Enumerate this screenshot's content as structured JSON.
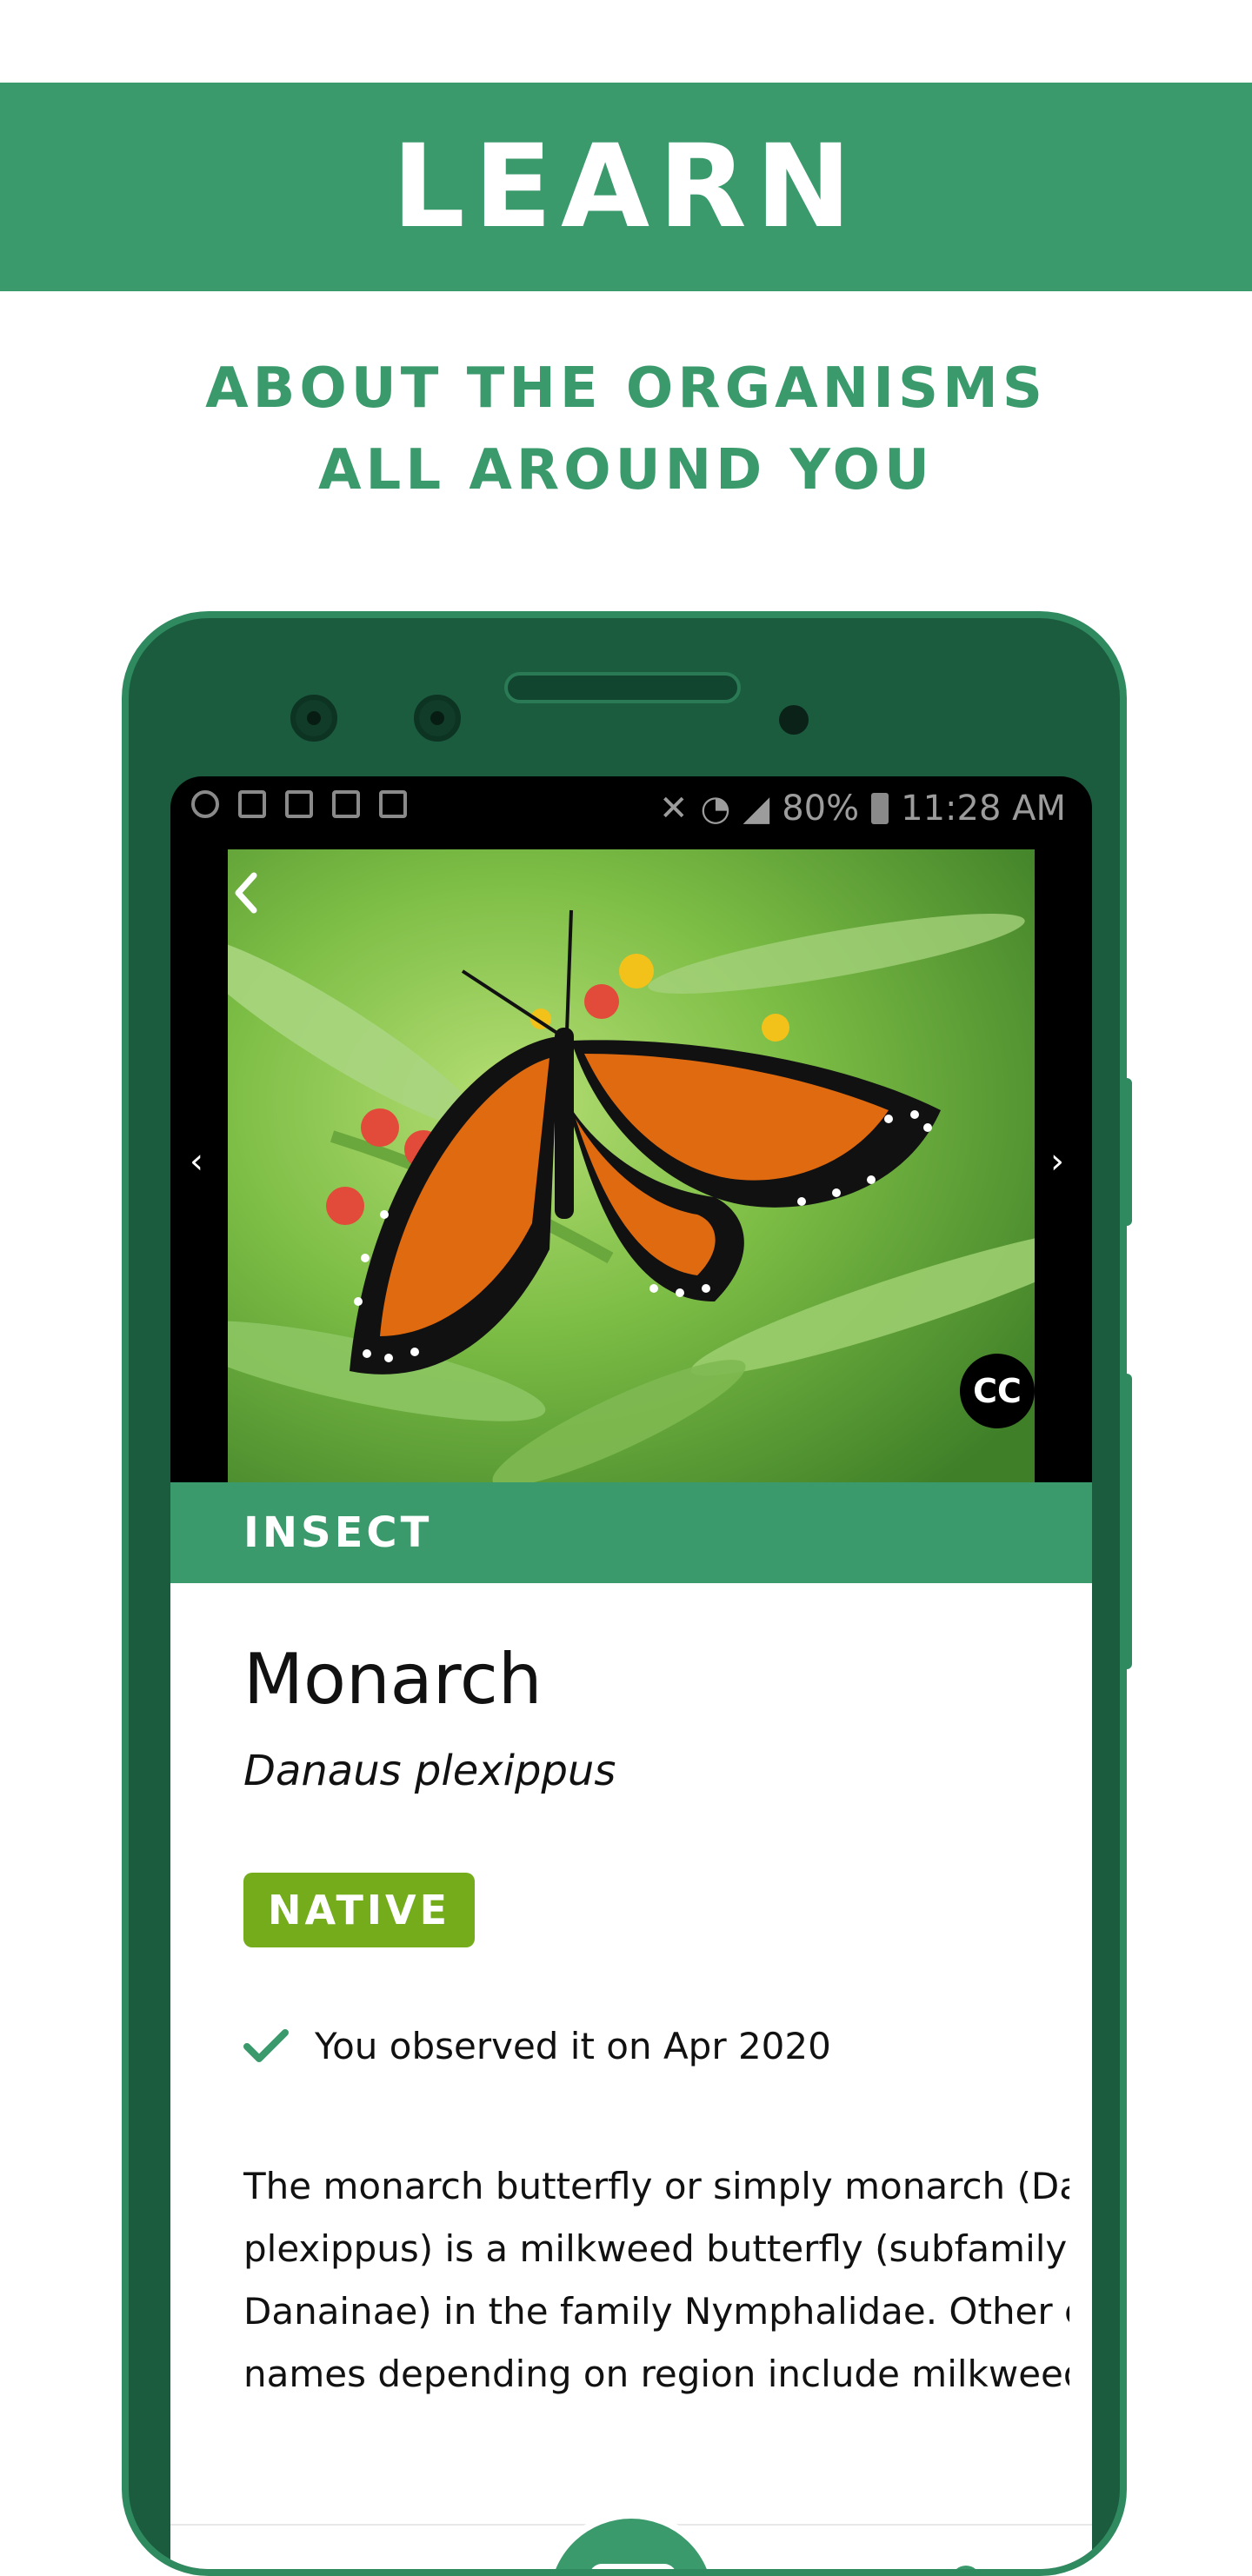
{
  "banner": {
    "title": "LEARN"
  },
  "subtitle": {
    "line1": "ABOUT THE ORGANISMS",
    "line2": "ALL AROUND YOU"
  },
  "statusbar": {
    "battery": "80%",
    "time": "11:28 AM"
  },
  "photo": {
    "cc_label": "CC"
  },
  "organism": {
    "category": "INSECT",
    "common_name": "Monarch",
    "scientific_name": "Danaus plexippus",
    "status_badge": "NATIVE",
    "observed_text": "You observed it on Apr 2020",
    "description_lines": [
      "The monarch butterfly or simply monarch (Dan",
      "plexippus) is a milkweed butterfly (subfamily",
      "Danainae) in the family Nymphalidae. Other co",
      "names depending on region include milkweed,"
    ]
  },
  "colors": {
    "brand": "#3a9a6c",
    "phone_body": "#1b5c3f",
    "native": "#74ac1c"
  }
}
